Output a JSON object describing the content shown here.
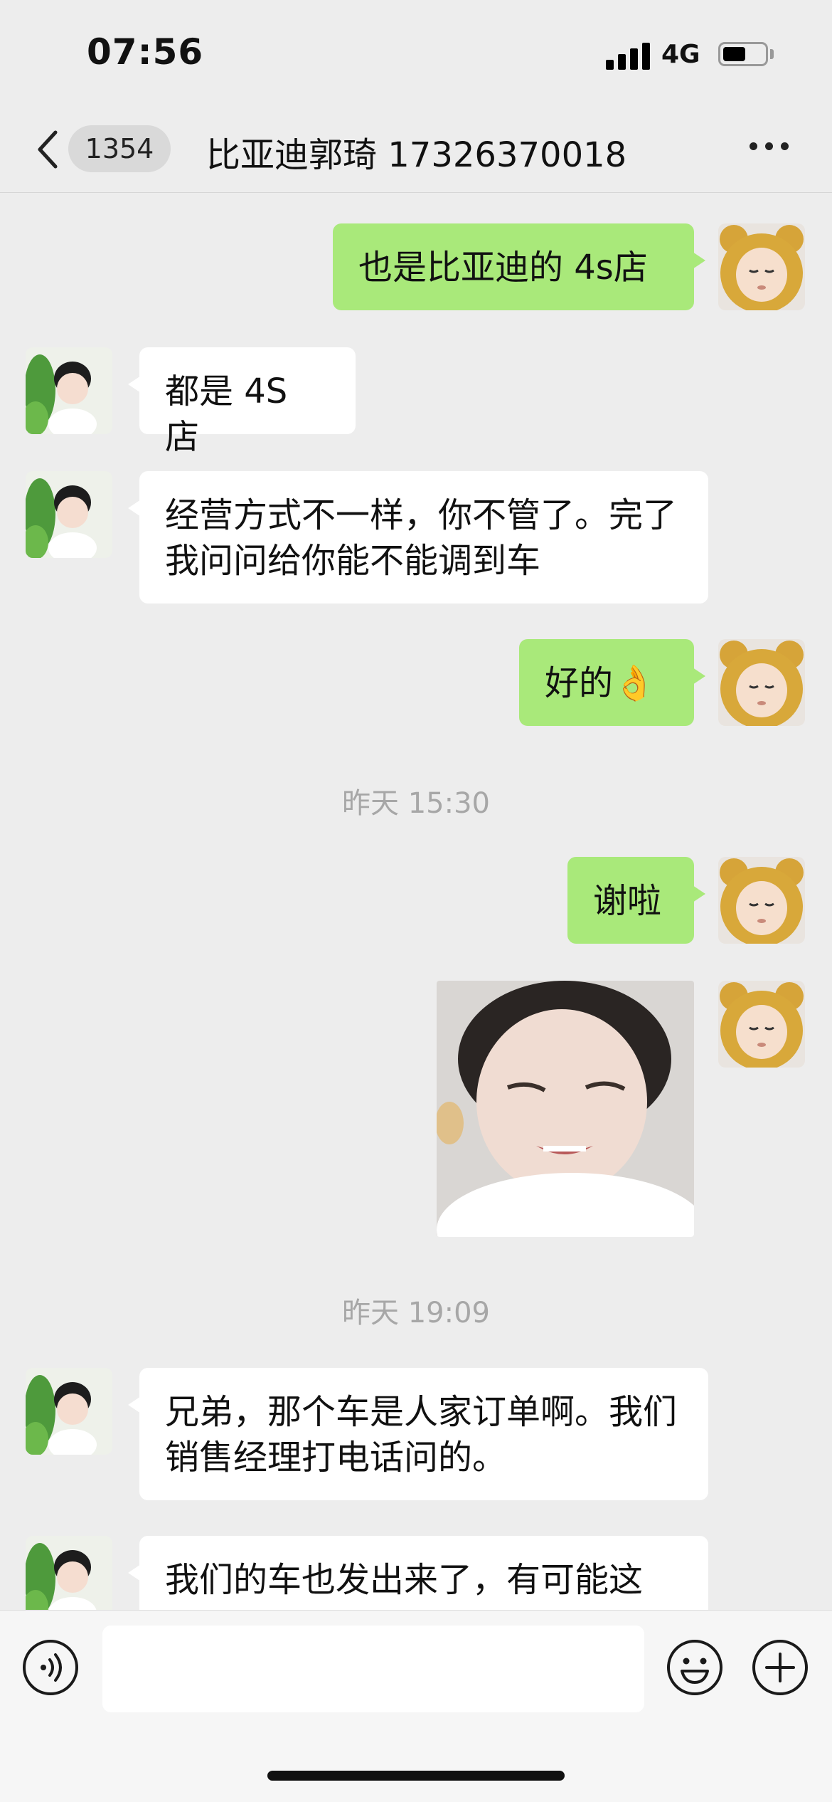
{
  "status_bar": {
    "time": "07:56",
    "network": "4G",
    "battery_level": 0.55
  },
  "nav": {
    "unread_count": "1354",
    "title": "比亚迪郭琦 17326370018"
  },
  "messages": [
    {
      "type": "text",
      "side": "sent",
      "text": "也是比亚迪的 4s店"
    },
    {
      "type": "text",
      "side": "received",
      "text": "都是 4S 店"
    },
    {
      "type": "text",
      "side": "received",
      "text": "经营方式不一样，你不管了。完了我问问给你能不能调到车"
    },
    {
      "type": "text",
      "side": "sent",
      "text": "好的👌"
    },
    {
      "type": "timestamp",
      "text": "昨天 15:30"
    },
    {
      "type": "text",
      "side": "sent",
      "text": "谢啦"
    },
    {
      "type": "sticker",
      "side": "sent",
      "name": "toddler-sticker"
    },
    {
      "type": "timestamp",
      "text": "昨天 19:09"
    },
    {
      "type": "text",
      "side": "received",
      "text": "兄弟，那个车是人家订单啊。我们销售经理打电话问的。"
    },
    {
      "type": "text",
      "side": "received",
      "text": "我们的车也发出来了，有可能这"
    }
  ],
  "input_bar": {
    "placeholder": "",
    "icons": [
      "voice-icon",
      "emoji-icon",
      "plus-icon"
    ]
  },
  "colors": {
    "sent_bubble": "#a9e97a",
    "received_bubble": "#ffffff",
    "chat_background": "#ededed"
  }
}
